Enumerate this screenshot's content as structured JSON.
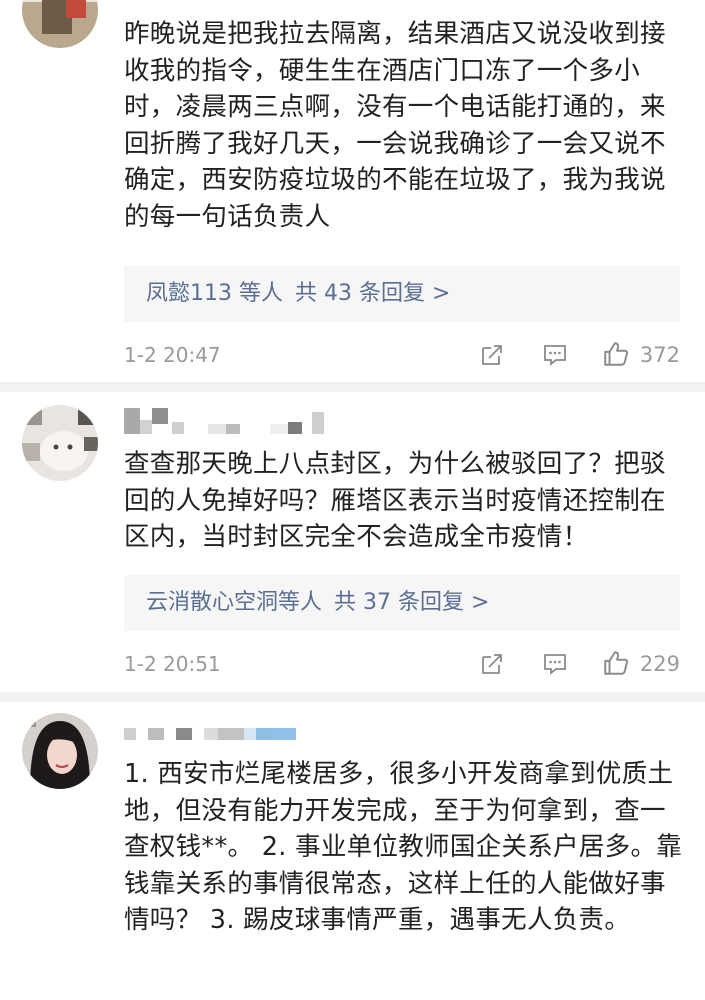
{
  "comments": [
    {
      "text": "昨晚说是把我拉去隔离，结果酒店又说没收到接收我的指令，硬生生在酒店门口冻了一个多小时，凌晨两三点啊，没有一个电话能打通的，来回折腾了我好几天，一会说我确诊了一会又说不确定，西安防疫垃圾的不能在垃圾了，我为我说的每一句话负责人",
      "reply_users": "凤懿113 等人",
      "reply_count": "共 43 条回复 >",
      "time": "1-2 20:47",
      "likes": "372"
    },
    {
      "text": "查查那天晚上八点封区，为什么被驳回了？把驳回的人免掉好吗？雁塔区表示当时疫情还控制在区内，当时封区完全不会造成全市疫情！",
      "reply_users": "云消散心空洞等人",
      "reply_count": "共 37 条回复 >",
      "time": "1-2 20:51",
      "likes": "229"
    },
    {
      "text": "1. 西安市烂尾楼居多，很多小开发商拿到优质土地，但没有能力开发完成，至于为何拿到，查一查权钱**。 2. 事业单位教师国企关系户居多。靠钱靠关系的事情很常态，这样上任的人能做好事情吗？ 3. 踢皮球事情严重，遇事无人负责。"
    }
  ],
  "icons": {
    "share": "share-icon",
    "comment": "comment-icon",
    "like": "thumbs-up-icon"
  },
  "colors": {
    "reply_link": "#5b6f92",
    "meta_gray": "#9a9a9a",
    "reply_bg": "#f6f6f6",
    "divider": "#f2f2f2"
  }
}
